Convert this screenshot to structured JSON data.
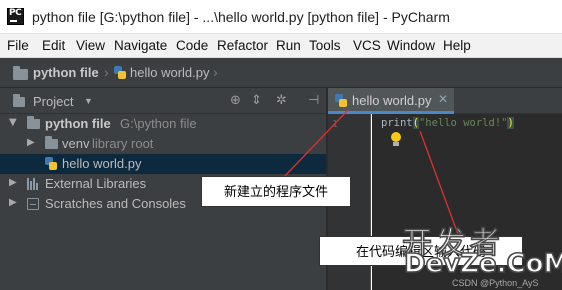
{
  "window": {
    "logo_text": "PC",
    "title": "python file [G:\\python file] - ...\\hello world.py [python file] - PyCharm"
  },
  "menu": [
    "File",
    "Edit",
    "View",
    "Navigate",
    "Code",
    "Refactor",
    "Run",
    "Tools",
    "VCS",
    "Window",
    "Help"
  ],
  "breadcrumb": {
    "project": "python file",
    "file": "hello world.py"
  },
  "project_panel": {
    "title": "Project",
    "icons": [
      "globe-icon",
      "collapse-all-icon",
      "settings-icon",
      "hide-icon"
    ],
    "tree": [
      {
        "label": "python file",
        "hint": "G:\\python file",
        "expanded": true
      },
      {
        "label": "venv",
        "hint": "library root",
        "expanded": false
      },
      {
        "label": "hello world.py",
        "selected": true
      },
      {
        "label": "External Libraries",
        "expanded": false
      },
      {
        "label": "Scratches and Consoles",
        "expanded": false
      }
    ]
  },
  "editor": {
    "tab_label": "hello world.py",
    "line_number": "1",
    "code": {
      "func": "print",
      "open_paren": "(",
      "string": "\"hello world!\"",
      "close_paren": ")"
    }
  },
  "annotations": {
    "callout_file": "新建立的程序文件",
    "callout_code": "在代码编辑区输入代码"
  },
  "watermark": {
    "line1": "开发者",
    "line2": "DevZe.CoM",
    "line3": "CSDN @Python_AyS"
  },
  "colors": {
    "ide_dark": "#3c3f41",
    "editor_bg": "#2b2b2b",
    "selection": "#0d293e",
    "tab_accent": "#4a88c7",
    "annotation_line": "#e0302c"
  }
}
